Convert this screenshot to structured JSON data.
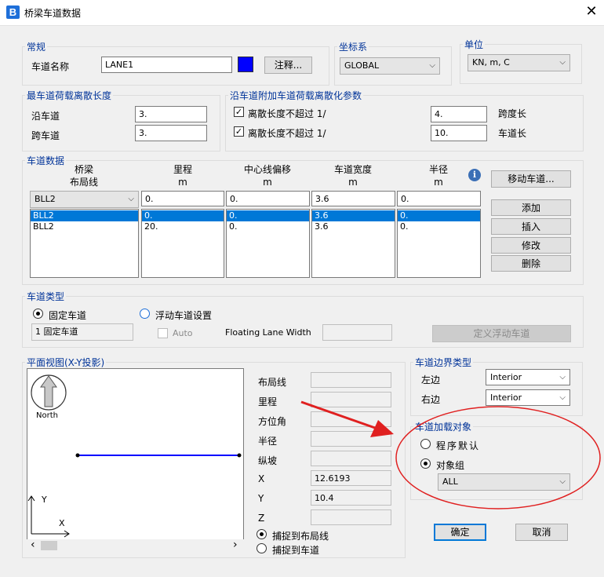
{
  "window": {
    "title": "桥梁车道数据",
    "app_icon_letter": "B",
    "close_glyph": "✕"
  },
  "general": {
    "legend": "常规",
    "lane_name_label": "车道名称",
    "lane_name_value": "LANE1",
    "lane_color": "#0000ff",
    "note_button": "注释..."
  },
  "coordinate_system": {
    "legend": "坐标系",
    "value": "GLOBAL"
  },
  "units": {
    "legend": "单位",
    "value": "KN, m, C"
  },
  "discretization": {
    "legend": "最车道荷载离散长度",
    "along_label": "沿车道",
    "along_value": "3.",
    "across_label": "跨车道",
    "across_value": "3."
  },
  "additional": {
    "legend": "沿车道附加车道荷载离散化参数",
    "row1_label": "离散长度不超过 1/",
    "row1_value": "4.",
    "row1_unit": "跨度长",
    "row2_label": "离散长度不超过 1/",
    "row2_value": "10.",
    "row2_unit": "车道长"
  },
  "lane_data": {
    "legend": "车道数据",
    "headers": [
      {
        "line1": "桥梁",
        "line2": "布局线"
      },
      {
        "line1": "里程",
        "line2": "m"
      },
      {
        "line1": "中心线偏移",
        "line2": "m"
      },
      {
        "line1": "车道宽度",
        "line2": "m"
      },
      {
        "line1": "半径",
        "line2": "m"
      }
    ],
    "edit_row": {
      "layout": "BLL2",
      "station": "0.",
      "offset": "0.",
      "width": "3.6",
      "radius": "0."
    },
    "rows": [
      {
        "layout": "BLL2",
        "station": "0.",
        "offset": "0.",
        "width": "3.6",
        "radius": "0."
      },
      {
        "layout": "BLL2",
        "station": "20.",
        "offset": "0.",
        "width": "3.6",
        "radius": "0."
      }
    ],
    "info_glyph": "i",
    "move_button": "移动车道...",
    "add_button": "添加",
    "insert_button": "插入",
    "modify_button": "修改",
    "delete_button": "删除"
  },
  "lane_type": {
    "legend": "车道类型",
    "fixed_label": "固定车道",
    "floating_label": "浮动车道设置",
    "fixed_value": "1 固定车道",
    "auto_label": "Auto",
    "floating_width_label": "Floating Lane Width",
    "floating_width_value": "",
    "define_button": "定义浮动车道"
  },
  "plan_view": {
    "legend": "平面视图(X-Y投影)",
    "north_label": "North",
    "axis_y": "Y",
    "axis_x": "X",
    "lane_color": "#0000ff",
    "scroll_left": "‹",
    "scroll_right": "›",
    "fields": [
      {
        "label": "布局线",
        "value": ""
      },
      {
        "label": "里程",
        "value": ""
      },
      {
        "label": "方位角",
        "value": ""
      },
      {
        "label": "半径",
        "value": ""
      },
      {
        "label": "纵坡",
        "value": ""
      },
      {
        "label": "X",
        "value": "12.6193"
      },
      {
        "label": "Y",
        "value": "10.4"
      },
      {
        "label": "Z",
        "value": ""
      }
    ],
    "snap_layout": "捕捉到布局线",
    "snap_lane": "捕捉到车道"
  },
  "boundary": {
    "legend": "车道边界类型",
    "left_label": "左边",
    "left_value": "Interior",
    "right_label": "右边",
    "right_value": "Interior"
  },
  "loading_object": {
    "legend": "车道加载对象",
    "default_label": "程序默认",
    "group_label": "对象组",
    "group_value": "ALL"
  },
  "annotation": {
    "color": "#e02020"
  },
  "footer": {
    "ok_button": "确定",
    "cancel_button": "取消"
  }
}
